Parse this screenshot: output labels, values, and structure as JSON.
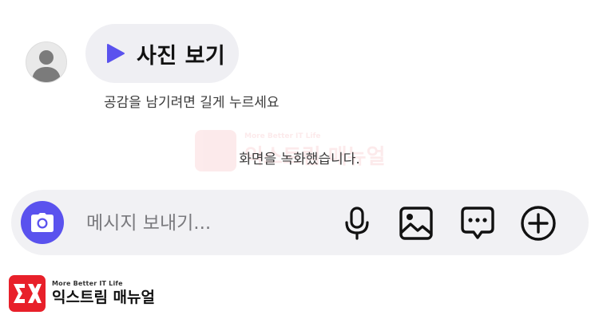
{
  "message": {
    "label": "사진 보기",
    "reaction_hint": "공감을 남기려면 길게 누르세요",
    "icon": "play-icon"
  },
  "avatar": {
    "icon": "person-silhouette-icon"
  },
  "system_message": "화면을 녹화했습니다.",
  "input_bar": {
    "placeholder": "메시지 보내기...",
    "value": "",
    "buttons": {
      "camera": "camera-icon",
      "microphone": "microphone-icon",
      "gallery": "image-icon",
      "sticker": "chat-bubble-dots-icon",
      "more": "plus-circle-icon"
    }
  },
  "watermark": {
    "tagline": "More Better IT Life",
    "name": "익스트림 매뉴얼"
  },
  "brand": {
    "tagline": "More Better IT Life",
    "name": "익스트림 매뉴얼"
  },
  "colors": {
    "accent": "#5a52ee",
    "bubble": "#efeff3",
    "input_bar": "#f1f1f4",
    "brand_red": "#e8202a"
  }
}
